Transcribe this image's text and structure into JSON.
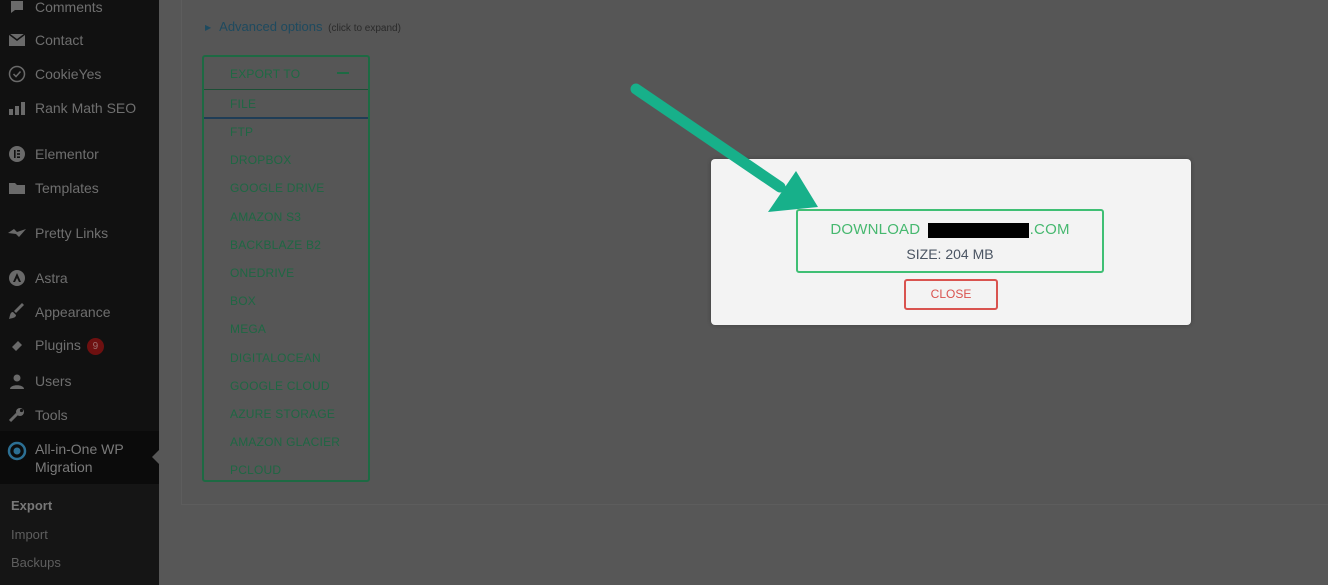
{
  "sidebar": {
    "items": [
      {
        "label": "Comments",
        "icon": "comment-icon"
      },
      {
        "label": "Contact",
        "icon": "mail-icon"
      },
      {
        "label": "CookieYes",
        "icon": "cookieyes-icon"
      },
      {
        "label": "Rank Math SEO",
        "icon": "rank-math-icon"
      },
      {
        "label": "Elementor",
        "icon": "elementor-icon"
      },
      {
        "label": "Templates",
        "icon": "folder-icon"
      },
      {
        "label": "Pretty Links",
        "icon": "pretty-links-icon"
      },
      {
        "label": "Astra",
        "icon": "astra-icon"
      },
      {
        "label": "Appearance",
        "icon": "paintbrush-icon"
      },
      {
        "label": "Plugins",
        "icon": "plugin-icon",
        "badge": "9"
      },
      {
        "label": "Users",
        "icon": "user-icon"
      },
      {
        "label": "Tools",
        "icon": "wrench-icon"
      }
    ],
    "active": {
      "label": "All-in-One WP Migration",
      "icon": "ai1wm-icon"
    },
    "submenu": [
      {
        "label": "Export",
        "current": true
      },
      {
        "label": "Import"
      },
      {
        "label": "Backups"
      }
    ]
  },
  "main": {
    "advanced": {
      "label": "Advanced options",
      "hint": "(click to expand)"
    },
    "export_panel": {
      "title": "EXPORT TO",
      "options": [
        "FILE",
        "FTP",
        "DROPBOX",
        "GOOGLE DRIVE",
        "AMAZON S3",
        "BACKBLAZE B2",
        "ONEDRIVE",
        "BOX",
        "MEGA",
        "DIGITALOCEAN",
        "GOOGLE CLOUD",
        "AZURE STORAGE",
        "AMAZON GLACIER",
        "PCLOUD"
      ]
    }
  },
  "modal": {
    "download_prefix": "DOWNLOAD ",
    "download_suffix": ".COM",
    "size": "SIZE: 204 MB",
    "close": "CLOSE"
  },
  "colors": {
    "accent_green": "#3fbf74",
    "close_red": "#d9534f",
    "annotation_arrow": "#17b08a"
  }
}
